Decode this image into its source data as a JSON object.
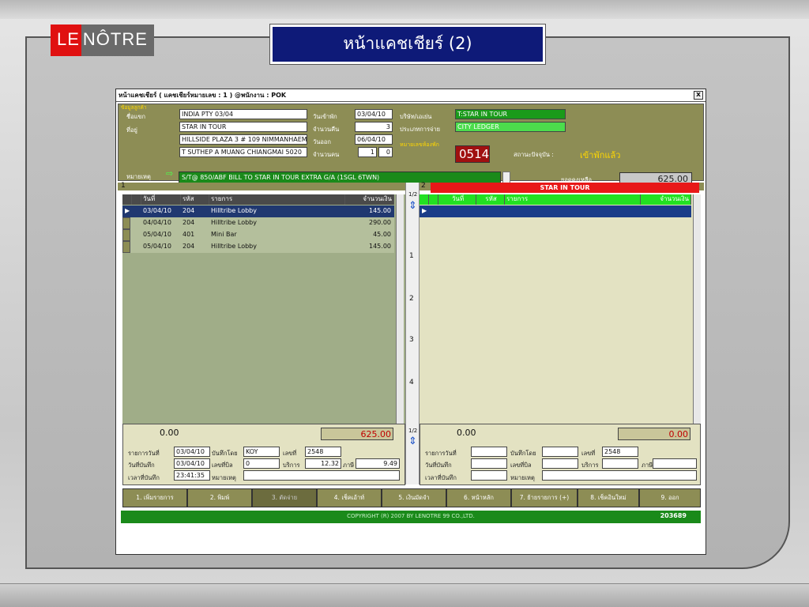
{
  "slide": {
    "logo_le": "LE",
    "logo_notre": "NÔTRE",
    "title": "หน้าแคชเชียร์ (2)"
  },
  "window": {
    "title": "หน้าแคชเชียร์    ( แคชเชียร์หมายเลข : 1 ) @พนักงาน : POK",
    "close": "x"
  },
  "info": {
    "group_label": "ข้อมูลลูกค้า",
    "guest_label": "ชื่อแขก",
    "guest": "INDIA PTY 03/04",
    "address_label": "ที่อยู่",
    "address1": "STAR IN TOUR",
    "address2": "HILLSIDE PLAZA 3 # 109 NIMMANHAEM",
    "address3": "T SUTHEP A MUANG  CHIANGMAI 5020",
    "checkin_label": "วันเข้าพัก",
    "checkin": "03/04/10",
    "nights_label": "จำนวนคืน",
    "nights": "3",
    "checkout_label": "วันออก",
    "checkout": "06/04/10",
    "persons_label": "จำนวนคน",
    "adults": "1",
    "children": "0",
    "company_label": "บริษัท/เอเย่น",
    "company": "T:STAR IN TOUR",
    "paytype_label": "ประเภทการจ่าย",
    "paytype": "CITY LEDGER",
    "room_label": "หมายเลขห้องพัก",
    "room": "0514",
    "status_label": "สถานะปัจจุบัน :",
    "status": "เข้าพักแล้ว",
    "remark_label": "หมายเหตุ",
    "remark": "S/T@ 850/ABF  BILL TO STAR IN  TOUR  EXTRA G/A  (1SGL 6TWN)",
    "balance_label": "ยอดคงเหลือ",
    "balance": "625.00"
  },
  "folio1": {
    "tag": "1",
    "headers": [
      "วันที่",
      "รหัส",
      "รายการ",
      "จำนวนเงิน"
    ],
    "rows": [
      {
        "date": "03/04/10",
        "code": "204",
        "item": "Hilltribe Lobby",
        "amount": "145.00"
      },
      {
        "date": "04/04/10",
        "code": "204",
        "item": "Hilltribe Lobby",
        "amount": "290.00"
      },
      {
        "date": "05/04/10",
        "code": "401",
        "item": "Mini Bar",
        "amount": "45.00"
      },
      {
        "date": "05/04/10",
        "code": "204",
        "item": "Hilltribe Lobby",
        "amount": "145.00"
      }
    ],
    "total_left": "0.00",
    "total_right": "625.00",
    "detail": {
      "post_date_label": "รายการวันที่",
      "post_date": "03/04/10",
      "record_date_label": "วันที่บันทึก",
      "record_date": "03/04/10",
      "record_time_label": "เวลาที่บันทึก",
      "record_time": "23:41:35",
      "by_label": "บันทึกโดย",
      "by": "KOY",
      "bill_label": "เลขที่บิล",
      "bill": "0",
      "remark_label": "หมายเหตุ",
      "no_label": "เลขที่",
      "no": "2548",
      "service_label": "บริการ",
      "service": "12.32",
      "tax_label": "ภาษี",
      "tax": "9.49"
    }
  },
  "folio2": {
    "tag": "2",
    "banner": "STAR IN TOUR",
    "headers": [
      "วันที่",
      "รหัส",
      "รายการ",
      "จำนวนเงิน"
    ],
    "total_left": "0.00",
    "total_right": "0.00",
    "detail": {
      "post_date_label": "รายการวันที่",
      "record_date_label": "วันที่บันทึก",
      "record_time_label": "เวลาที่บันทึก",
      "by_label": "บันทึกโดย",
      "bill_label": "เลขที่บิล",
      "remark_label": "หมายเหตุ",
      "no_label": "เลขที่",
      "no": "2548",
      "service_label": "บริการ",
      "tax_label": "ภาษี"
    }
  },
  "middle": {
    "nums": [
      "1",
      "2",
      "3",
      "4"
    ],
    "top_label": "1/2",
    "bottom_label": "1/2"
  },
  "buttons": [
    "1. เพิ่มรายการ",
    "2. พิมพ์",
    "3. ตัดจ่าย",
    "4. เช็คเอ้าท์",
    "5. เงินมัดจำ",
    "6. หน้าหลัก",
    "7. ย้ายรายการ (+)",
    "8. เช็คอินใหม่",
    "9. ออก"
  ],
  "footer": {
    "copyright": "COPYRIGHT (R) 2007 BY LENOTRE 99 CO.,LTD.",
    "code": "203689"
  }
}
